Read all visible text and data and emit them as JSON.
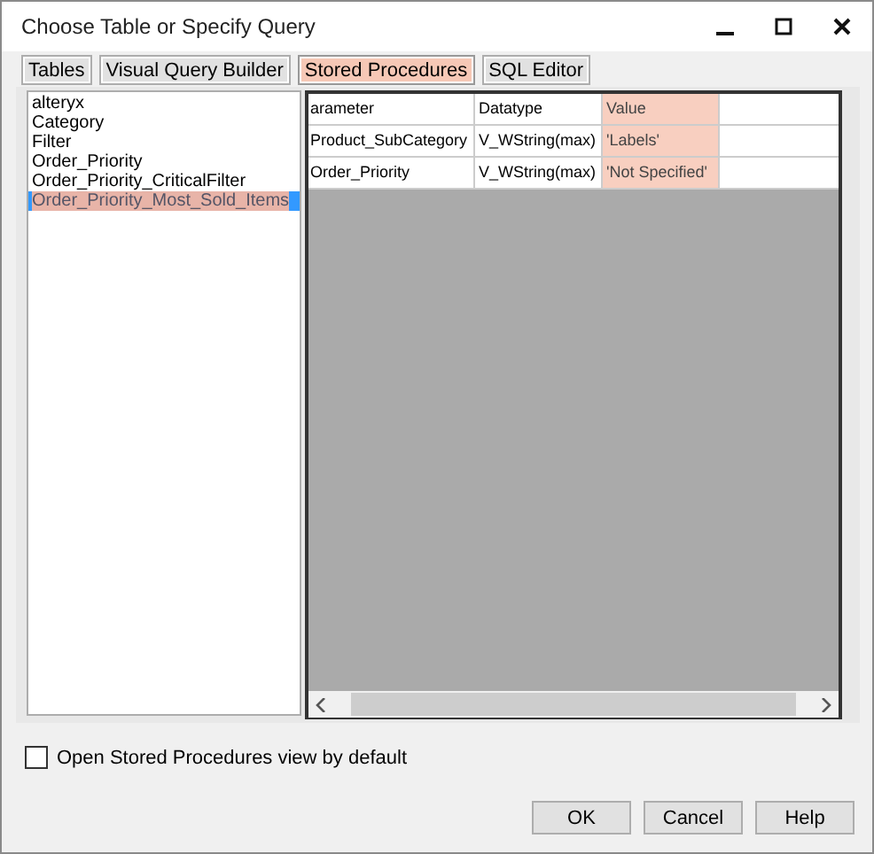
{
  "window": {
    "title": "Choose Table or Specify Query"
  },
  "tabs": [
    {
      "label": "Tables",
      "selected": false
    },
    {
      "label": "Visual Query Builder",
      "selected": false
    },
    {
      "label": "Stored Procedures",
      "selected": true
    },
    {
      "label": "SQL Editor",
      "selected": false
    }
  ],
  "procedures": [
    {
      "label": "alteryx",
      "selected": false
    },
    {
      "label": "Category",
      "selected": false
    },
    {
      "label": "Filter",
      "selected": false
    },
    {
      "label": "Order_Priority",
      "selected": false
    },
    {
      "label": "Order_Priority_CriticalFilter",
      "selected": false
    },
    {
      "label": "Order_Priority_Most_Sold_Items",
      "selected": true
    }
  ],
  "table": {
    "columns": [
      {
        "label": "arameter",
        "highlighted": false
      },
      {
        "label": "Datatype",
        "highlighted": false
      },
      {
        "label": "Value",
        "highlighted": true
      }
    ],
    "rows": [
      [
        "Product_SubCategory",
        "V_WString(max)",
        "'Labels'"
      ],
      [
        "Order_Priority",
        "V_WString(max)",
        "'Not Specified'"
      ]
    ]
  },
  "default_view_checkbox": {
    "label": "Open Stored Procedures view by default",
    "checked": false
  },
  "buttons": [
    "OK",
    "Cancel",
    "Help"
  ]
}
